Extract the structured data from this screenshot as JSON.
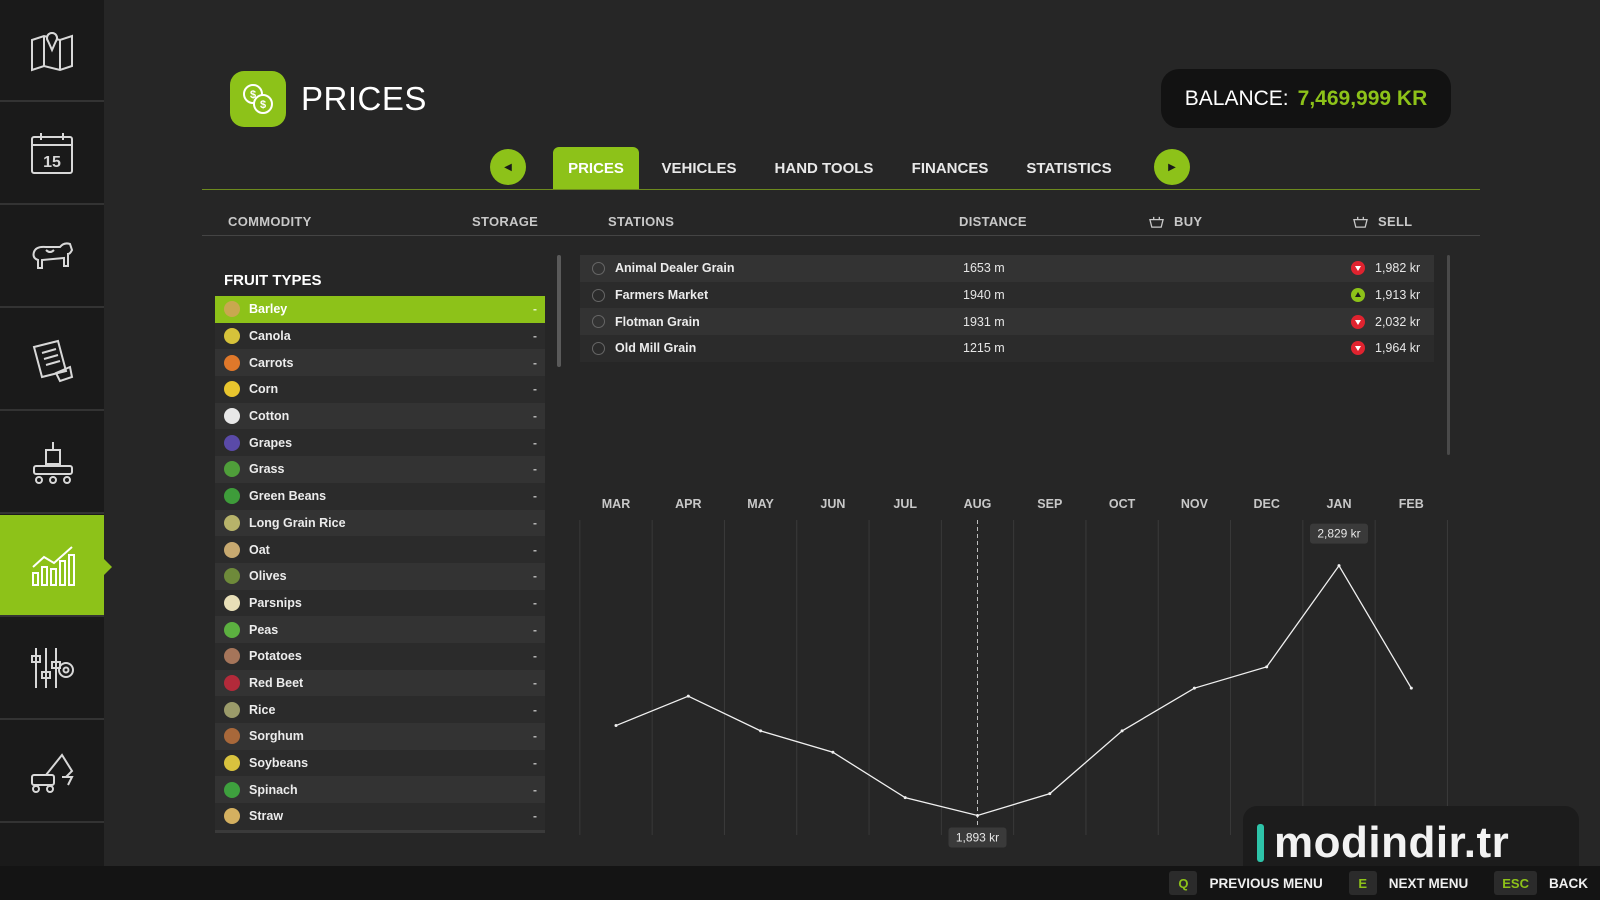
{
  "header": {
    "title": "PRICES",
    "balance_label": "BALANCE:",
    "balance_value": "7,469,999 KR"
  },
  "sidebar": {
    "items": [
      {
        "icon": "map-icon",
        "active": false
      },
      {
        "icon": "calendar-icon",
        "label": "15",
        "active": false
      },
      {
        "icon": "cow-icon",
        "active": false
      },
      {
        "icon": "contracts-icon",
        "active": false
      },
      {
        "icon": "production-icon",
        "active": false
      },
      {
        "icon": "statistics-chart-icon",
        "active": true
      },
      {
        "icon": "settings-sliders-icon",
        "active": false
      },
      {
        "icon": "construction-icon",
        "active": false
      }
    ]
  },
  "tabs": {
    "items": [
      {
        "label": "PRICES",
        "active": true
      },
      {
        "label": "VEHICLES",
        "active": false
      },
      {
        "label": "HAND TOOLS",
        "active": false
      },
      {
        "label": "FINANCES",
        "active": false
      },
      {
        "label": "STATISTICS",
        "active": false
      }
    ],
    "prev_icon": "arrow-left-icon",
    "next_icon": "arrow-right-icon"
  },
  "columns": {
    "commodity": "COMMODITY",
    "storage": "STORAGE",
    "stations": "STATIONS",
    "distance": "DISTANCE",
    "buy": "BUY",
    "sell": "SELL"
  },
  "fruit_section": {
    "title": "FRUIT TYPES",
    "items": [
      {
        "name": "Barley",
        "storage": "-",
        "selected": true,
        "color": "#c9a84f"
      },
      {
        "name": "Canola",
        "storage": "-",
        "color": "#d6c23a"
      },
      {
        "name": "Carrots",
        "storage": "-",
        "color": "#e0782a"
      },
      {
        "name": "Corn",
        "storage": "-",
        "color": "#e8c52e"
      },
      {
        "name": "Cotton",
        "storage": "-",
        "color": "#e8e8e8"
      },
      {
        "name": "Grapes",
        "storage": "-",
        "color": "#5a4aa8"
      },
      {
        "name": "Grass",
        "storage": "-",
        "color": "#4f9e3a"
      },
      {
        "name": "Green Beans",
        "storage": "-",
        "color": "#3e9c3a"
      },
      {
        "name": "Long Grain Rice",
        "storage": "-",
        "color": "#b7b36a"
      },
      {
        "name": "Oat",
        "storage": "-",
        "color": "#c7a970"
      },
      {
        "name": "Olives",
        "storage": "-",
        "color": "#6e8a3a"
      },
      {
        "name": "Parsnips",
        "storage": "-",
        "color": "#e8dfb8"
      },
      {
        "name": "Peas",
        "storage": "-",
        "color": "#5cb040"
      },
      {
        "name": "Potatoes",
        "storage": "-",
        "color": "#a5755a"
      },
      {
        "name": "Red Beet",
        "storage": "-",
        "color": "#b32a3a"
      },
      {
        "name": "Rice",
        "storage": "-",
        "color": "#9b9b6a"
      },
      {
        "name": "Sorghum",
        "storage": "-",
        "color": "#a8683a"
      },
      {
        "name": "Soybeans",
        "storage": "-",
        "color": "#d8c23e"
      },
      {
        "name": "Spinach",
        "storage": "-",
        "color": "#3ea03e"
      },
      {
        "name": "Straw",
        "storage": "-",
        "color": "#d4b060"
      }
    ]
  },
  "stations": [
    {
      "name": "Animal Dealer Grain",
      "distance": "1653 m",
      "trend": "down",
      "price": "1,982 kr"
    },
    {
      "name": "Farmers Market",
      "distance": "1940 m",
      "trend": "up",
      "price": "1,913 kr"
    },
    {
      "name": "Flotman Grain",
      "distance": "1931 m",
      "trend": "down",
      "price": "2,032 kr"
    },
    {
      "name": "Old Mill Grain",
      "distance": "1215 m",
      "trend": "down",
      "price": "1,964 kr"
    }
  ],
  "chart_data": {
    "type": "line",
    "categories": [
      "MAR",
      "APR",
      "MAY",
      "JUN",
      "JUL",
      "AUG",
      "SEP",
      "OCT",
      "NOV",
      "DEC",
      "JAN",
      "FEB"
    ],
    "values": [
      2230,
      2340,
      2210,
      2130,
      1960,
      1893,
      1975,
      2210,
      2370,
      2450,
      2829,
      2370
    ],
    "ylim": [
      1820,
      3000
    ],
    "current_month": "AUG",
    "annotations": [
      {
        "category": "JAN",
        "text": "2,829 kr"
      },
      {
        "category": "AUG",
        "text": "1,893 kr"
      }
    ]
  },
  "watermark": {
    "text": "modindir.tr"
  },
  "footer": {
    "items": [
      {
        "key": "Q",
        "label": "PREVIOUS MENU"
      },
      {
        "key": "E",
        "label": "NEXT MENU"
      },
      {
        "key": "ESC",
        "label": "BACK"
      }
    ]
  }
}
